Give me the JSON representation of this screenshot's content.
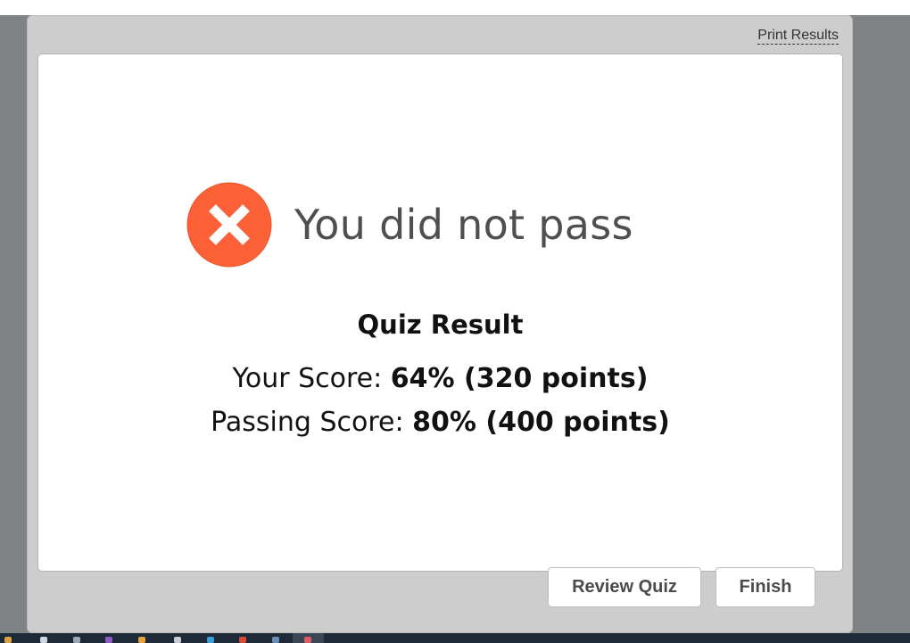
{
  "header": {
    "print_results_label": "Print Results"
  },
  "result": {
    "status_text": "You did not pass",
    "title": "Quiz Result",
    "your_score_label": "Your Score: ",
    "your_score_value": "64% (320 points)",
    "passing_score_label": "Passing Score: ",
    "passing_score_value": "80% (400 points)"
  },
  "buttons": {
    "review_label": "Review Quiz",
    "finish_label": "Finish"
  },
  "colors": {
    "fail_icon": "#fc6036",
    "frame": "#cdcdcd",
    "backdrop": "#7f8386"
  },
  "icons": {
    "status": "close-x-circle-icon"
  }
}
